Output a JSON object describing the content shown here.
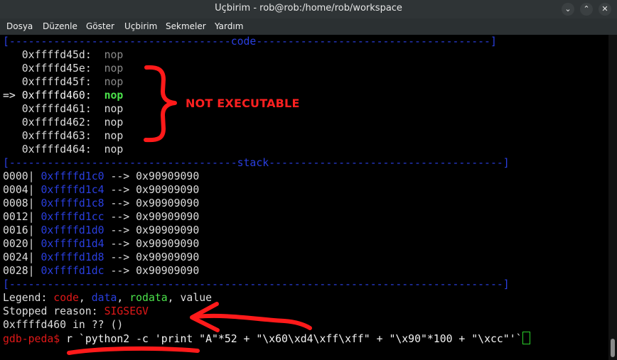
{
  "window": {
    "title": "Uçbirim - rob@rob:/home/rob/workspace"
  },
  "menu": [
    "Dosya",
    "Düzenle",
    "Göster",
    "Uçbirim",
    "Sekmeler",
    "Yardım"
  ],
  "code_header": "[-----------------------------------code-------------------------------------]",
  "code_lines": [
    {
      "arrow": "  ",
      "addr": "0xffffd45d:",
      "instr": "nop"
    },
    {
      "arrow": "  ",
      "addr": "0xffffd45e:",
      "instr": "nop"
    },
    {
      "arrow": "  ",
      "addr": "0xffffd45f:",
      "instr": "nop"
    },
    {
      "arrow": "=>",
      "addr": "0xffffd460:",
      "instr": "nop"
    },
    {
      "arrow": "  ",
      "addr": "0xffffd461:",
      "instr": "nop"
    },
    {
      "arrow": "  ",
      "addr": "0xffffd462:",
      "instr": "nop"
    },
    {
      "arrow": "  ",
      "addr": "0xffffd463:",
      "instr": "nop"
    },
    {
      "arrow": "  ",
      "addr": "0xffffd464:",
      "instr": "nop"
    }
  ],
  "stack_header": "[------------------------------------stack-------------------------------------]",
  "stack_lines": [
    {
      "off": "0000|",
      "addr": "0xffffd1c0",
      "arrow": "-->",
      "val": "0x90909090"
    },
    {
      "off": "0004|",
      "addr": "0xffffd1c4",
      "arrow": "-->",
      "val": "0x90909090"
    },
    {
      "off": "0008|",
      "addr": "0xffffd1c8",
      "arrow": "-->",
      "val": "0x90909090"
    },
    {
      "off": "0012|",
      "addr": "0xffffd1cc",
      "arrow": "-->",
      "val": "0x90909090"
    },
    {
      "off": "0016|",
      "addr": "0xffffd1d0",
      "arrow": "-->",
      "val": "0x90909090"
    },
    {
      "off": "0020|",
      "addr": "0xffffd1d4",
      "arrow": "-->",
      "val": "0x90909090"
    },
    {
      "off": "0024|",
      "addr": "0xffffd1d8",
      "arrow": "-->",
      "val": "0x90909090"
    },
    {
      "off": "0028|",
      "addr": "0xffffd1dc",
      "arrow": "-->",
      "val": "0x90909090"
    }
  ],
  "separator": "[------------------------------------------------------------------------------]",
  "legend": {
    "label": "Legend:",
    "code": "code",
    "data": "data",
    "rodata": "rodata",
    "value": "value",
    "sep": ", "
  },
  "stopped": {
    "label": "Stopped reason:",
    "reason": "SIGSEGV"
  },
  "location": "0xffffd460 in ?? ()",
  "prompt": {
    "text": "gdb-peda$",
    "command": "r `python2 -c 'print \"A\"*52 + \"\\x60\\xd4\\xff\\xff\" + \"\\x90\"*100 + \"\\xcc\"'`"
  },
  "annotation": {
    "text": "NOT EXECUTABLE",
    "color": "#ff2020"
  },
  "colors": {
    "code": "#e01818",
    "data": "#2a3fe0",
    "rodata": "#4be34b",
    "cursor": "#2ad12a"
  },
  "icons": [
    "chevron-down-icon",
    "chevron-up-icon",
    "close-icon"
  ]
}
